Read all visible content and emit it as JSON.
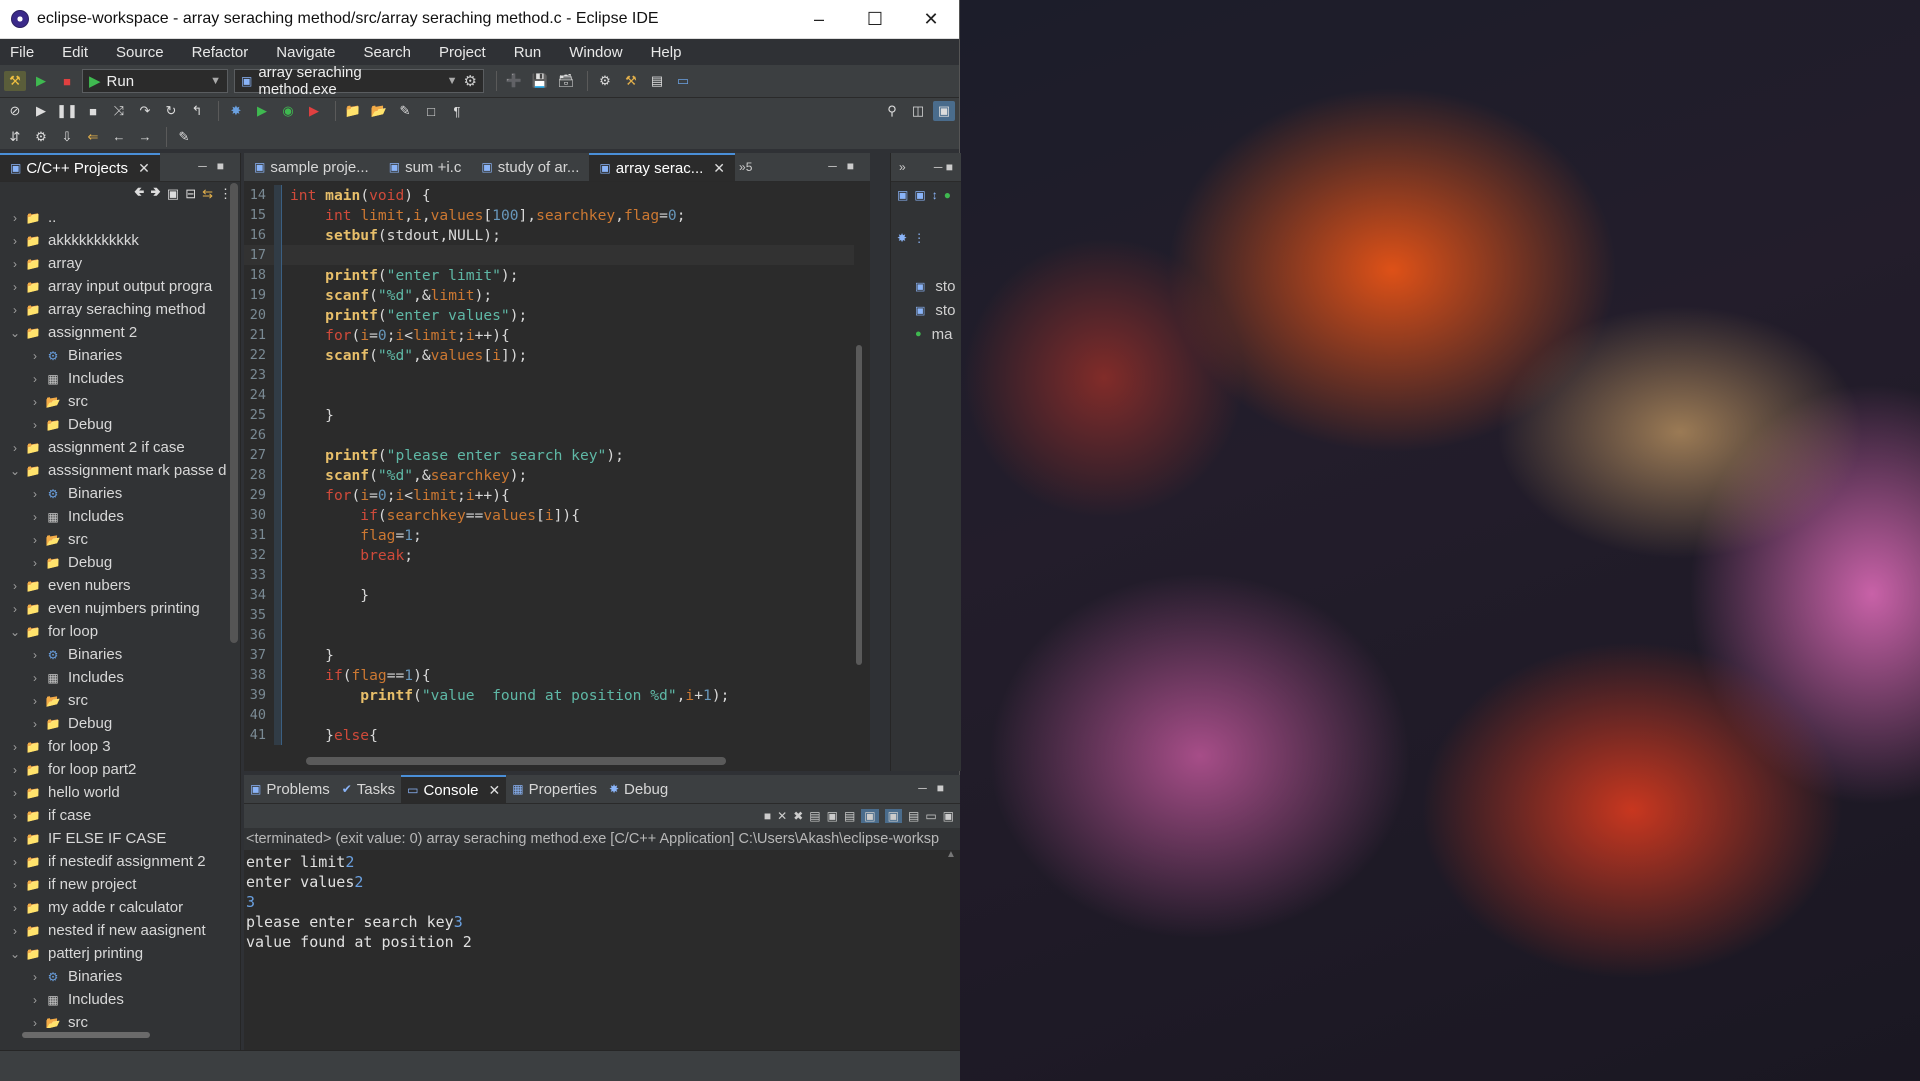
{
  "window": {
    "title": "eclipse-workspace - array seraching method/src/array seraching method.c - Eclipse IDE",
    "minimize": "–",
    "maximize": "☐",
    "close": "✕"
  },
  "menu": [
    "File",
    "Edit",
    "Source",
    "Refactor",
    "Navigate",
    "Search",
    "Project",
    "Run",
    "Window",
    "Help"
  ],
  "toolbar": {
    "run_mode": "Run",
    "launch_target": "array seraching method.exe"
  },
  "explorer": {
    "tab": "C/C++ Projects",
    "nodes": [
      {
        "label": "..",
        "level": 1,
        "type": "project",
        "expanded": false
      },
      {
        "label": "akkkkkkkkkkk",
        "level": 1,
        "type": "project",
        "expanded": false
      },
      {
        "label": "array",
        "level": 1,
        "type": "project",
        "expanded": false
      },
      {
        "label": "array input output progra",
        "level": 1,
        "type": "project",
        "expanded": false
      },
      {
        "label": "array seraching method",
        "level": 1,
        "type": "project",
        "expanded": false
      },
      {
        "label": "assignment 2",
        "level": 1,
        "type": "project",
        "expanded": true
      },
      {
        "label": "Binaries",
        "level": 2,
        "type": "binaries"
      },
      {
        "label": "Includes",
        "level": 2,
        "type": "includes"
      },
      {
        "label": "src",
        "level": 2,
        "type": "src"
      },
      {
        "label": "Debug",
        "level": 2,
        "type": "debug"
      },
      {
        "label": "assignment 2 if case",
        "level": 1,
        "type": "project",
        "expanded": false
      },
      {
        "label": "asssignment mark passe d",
        "level": 1,
        "type": "project",
        "expanded": true
      },
      {
        "label": "Binaries",
        "level": 2,
        "type": "binaries"
      },
      {
        "label": "Includes",
        "level": 2,
        "type": "includes"
      },
      {
        "label": "src",
        "level": 2,
        "type": "src"
      },
      {
        "label": "Debug",
        "level": 2,
        "type": "debug"
      },
      {
        "label": "even nubers",
        "level": 1,
        "type": "project",
        "expanded": false
      },
      {
        "label": "even nujmbers printing",
        "level": 1,
        "type": "project",
        "expanded": false
      },
      {
        "label": "for loop",
        "level": 1,
        "type": "project",
        "expanded": true
      },
      {
        "label": "Binaries",
        "level": 2,
        "type": "binaries"
      },
      {
        "label": "Includes",
        "level": 2,
        "type": "includes"
      },
      {
        "label": "src",
        "level": 2,
        "type": "src"
      },
      {
        "label": "Debug",
        "level": 2,
        "type": "debug"
      },
      {
        "label": "for loop 3",
        "level": 1,
        "type": "project",
        "expanded": false
      },
      {
        "label": "for loop part2",
        "level": 1,
        "type": "project",
        "expanded": false
      },
      {
        "label": "hello world",
        "level": 1,
        "type": "project",
        "expanded": false
      },
      {
        "label": "if case",
        "level": 1,
        "type": "project",
        "expanded": false
      },
      {
        "label": "IF ELSE IF CASE",
        "level": 1,
        "type": "project",
        "expanded": false
      },
      {
        "label": "if nestedif assignment 2",
        "level": 1,
        "type": "project",
        "expanded": false
      },
      {
        "label": "if new project",
        "level": 1,
        "type": "project",
        "expanded": false
      },
      {
        "label": "my adde r calculator",
        "level": 1,
        "type": "project",
        "expanded": false
      },
      {
        "label": "nested if new aasignent",
        "level": 1,
        "type": "project",
        "expanded": false
      },
      {
        "label": "patterj printing",
        "level": 1,
        "type": "project",
        "expanded": true
      },
      {
        "label": "Binaries",
        "level": 2,
        "type": "binaries"
      },
      {
        "label": "Includes",
        "level": 2,
        "type": "includes"
      },
      {
        "label": "src",
        "level": 2,
        "type": "src"
      }
    ]
  },
  "editor": {
    "tabs": [
      {
        "label": "sample proje...",
        "active": false
      },
      {
        "label": "sum +i.c",
        "active": false
      },
      {
        "label": "study of ar...",
        "active": false
      },
      {
        "label": "array serac...",
        "active": true
      }
    ],
    "overflow": "»5",
    "lines": [
      {
        "n": "14",
        "html": "<span class='kw'>int</span> <span class='fn'>main</span>(<span class='kw'>void</span>) {"
      },
      {
        "n": "15",
        "html": "    <span class='kw'>int</span> <span class='var'>limit</span>,<span class='var'>i</span>,<span class='var'>values</span>[<span class='num'>100</span>],<span class='var'>searchkey</span>,<span class='var'>flag</span>=<span class='num'>0</span>;"
      },
      {
        "n": "16",
        "html": "    <span class='fn'>setbuf</span>(stdout,NULL);"
      },
      {
        "n": "17",
        "html": "",
        "current": true
      },
      {
        "n": "18",
        "html": "    <span class='fn'>printf</span>(<span class='str'>\"enter limit\"</span>);"
      },
      {
        "n": "19",
        "html": "    <span class='fn'>scanf</span>(<span class='str'>\"%d\"</span>,&amp;<span class='var'>limit</span>);"
      },
      {
        "n": "20",
        "html": "    <span class='fn'>printf</span>(<span class='str'>\"enter values\"</span>);"
      },
      {
        "n": "21",
        "html": "    <span class='kw'>for</span>(<span class='var'>i</span>=<span class='num'>0</span>;<span class='var'>i</span>&lt;<span class='var'>limit</span>;<span class='var'>i</span>++){"
      },
      {
        "n": "22",
        "html": "    <span class='fn'>scanf</span>(<span class='str'>\"%d\"</span>,&amp;<span class='var'>values</span>[<span class='var'>i</span>]);"
      },
      {
        "n": "23",
        "html": ""
      },
      {
        "n": "24",
        "html": ""
      },
      {
        "n": "25",
        "html": "    }"
      },
      {
        "n": "26",
        "html": ""
      },
      {
        "n": "27",
        "html": "    <span class='fn'>printf</span>(<span class='str'>\"please enter search key\"</span>);"
      },
      {
        "n": "28",
        "html": "    <span class='fn'>scanf</span>(<span class='str'>\"%d\"</span>,&amp;<span class='var'>searchkey</span>);"
      },
      {
        "n": "29",
        "html": "    <span class='kw'>for</span>(<span class='var'>i</span>=<span class='num'>0</span>;<span class='var'>i</span>&lt;<span class='var'>limit</span>;<span class='var'>i</span>++){"
      },
      {
        "n": "30",
        "html": "        <span class='kw'>if</span>(<span class='var'>searchkey</span>==<span class='var'>values</span>[<span class='var'>i</span>]){"
      },
      {
        "n": "31",
        "html": "        <span class='var'>flag</span>=<span class='num'>1</span>;"
      },
      {
        "n": "32",
        "html": "        <span class='kw'>break</span>;"
      },
      {
        "n": "33",
        "html": ""
      },
      {
        "n": "34",
        "html": "        }"
      },
      {
        "n": "35",
        "html": ""
      },
      {
        "n": "36",
        "html": ""
      },
      {
        "n": "37",
        "html": "    }"
      },
      {
        "n": "38",
        "html": "    <span class='kw'>if</span>(<span class='var'>flag</span>==<span class='num'>1</span>){"
      },
      {
        "n": "39",
        "html": "        <span class='fn'>printf</span>(<span class='str'>\"value  found at position %d\"</span>,<span class='var'>i</span>+<span class='num'>1</span>);"
      },
      {
        "n": "40",
        "html": ""
      },
      {
        "n": "41",
        "html": "    }<span class='kw'>else</span>{"
      }
    ]
  },
  "outline": {
    "items": [
      "sto",
      "sto",
      "ma"
    ]
  },
  "console": {
    "tabs": [
      {
        "label": "Problems",
        "active": false
      },
      {
        "label": "Tasks",
        "active": false
      },
      {
        "label": "Console",
        "active": true
      },
      {
        "label": "Properties",
        "active": false
      },
      {
        "label": "Debug",
        "active": false
      }
    ],
    "status": "<terminated> (exit value: 0) array seraching method.exe [C/C++ Application] C:\\Users\\Akash\\eclipse-worksp",
    "output": [
      {
        "text": "enter limit",
        "input": "2"
      },
      {
        "text": "enter values",
        "input": "2"
      },
      {
        "text": "",
        "input": "3"
      },
      {
        "text": "please enter search key",
        "input": "3"
      },
      {
        "text": "value  found at position 2",
        "input": ""
      }
    ]
  }
}
